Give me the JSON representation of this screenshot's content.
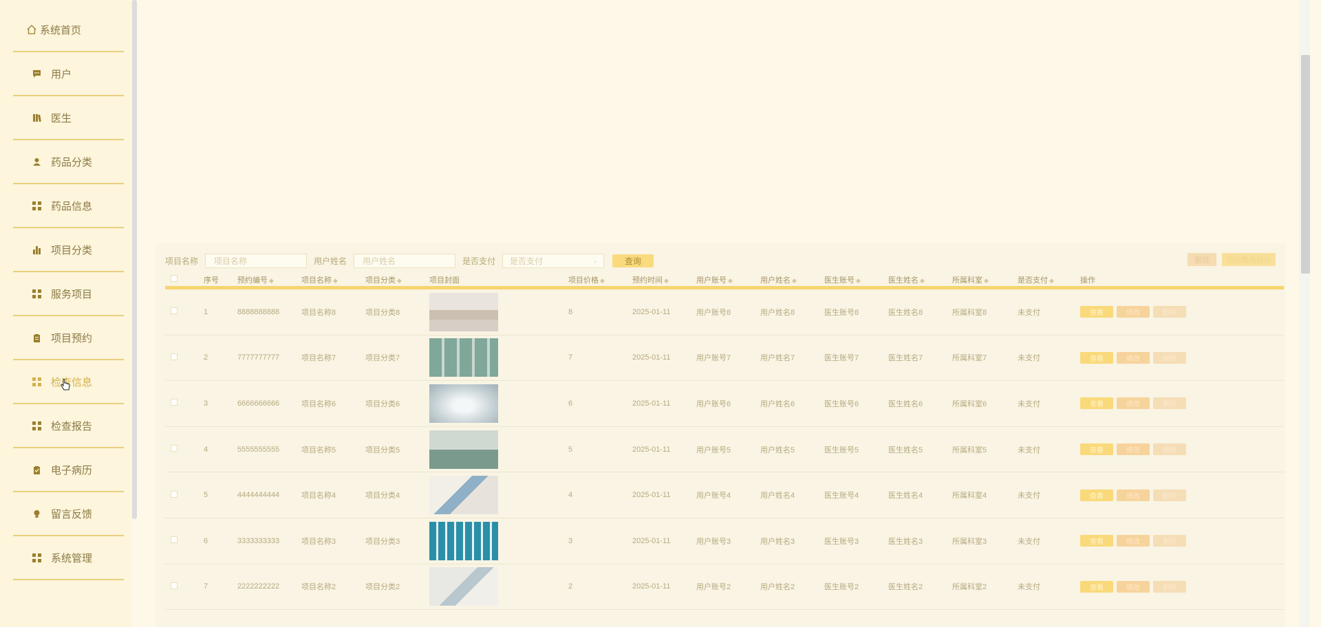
{
  "sidebar": {
    "items": [
      {
        "label": "系统首页",
        "icon": "home-icon"
      },
      {
        "label": "用户",
        "icon": "chat-icon"
      },
      {
        "label": "医生",
        "icon": "book-icon"
      },
      {
        "label": "药品分类",
        "icon": "user-icon"
      },
      {
        "label": "药品信息",
        "icon": "grid-icon"
      },
      {
        "label": "项目分类",
        "icon": "bar-chart-icon"
      },
      {
        "label": "服务项目",
        "icon": "grid-icon"
      },
      {
        "label": "项目预约",
        "icon": "clipboard-icon"
      },
      {
        "label": "检查信息",
        "icon": "grid-icon"
      },
      {
        "label": "检查报告",
        "icon": "grid-icon"
      },
      {
        "label": "电子病历",
        "icon": "clipboard-check-icon"
      },
      {
        "label": "留言反馈",
        "icon": "bulb-icon"
      },
      {
        "label": "系统管理",
        "icon": "grid-icon"
      }
    ]
  },
  "search": {
    "project_name_label": "项目名称",
    "project_name_placeholder": "项目名称",
    "user_name_label": "用户姓名",
    "user_name_placeholder": "用户姓名",
    "paid_label": "是否支付",
    "paid_placeholder": "是否支付",
    "query_button": "查询",
    "delete_button": "删除",
    "stat_button": "预约费用统计"
  },
  "table": {
    "headers": [
      "序号",
      "预约编号",
      "项目名称",
      "项目分类",
      "项目封面",
      "项目价格",
      "预约时间",
      "用户账号",
      "用户姓名",
      "医生账号",
      "医生姓名",
      "所属科室",
      "是否支付",
      "操作"
    ],
    "op_labels": {
      "view": "查看",
      "edit": "修改",
      "delete": "删除"
    },
    "rows": [
      {
        "no": "1",
        "code": "8888888888",
        "name": "项目名称8",
        "cat": "项目分类8",
        "price": "8",
        "time": "2025-01-11",
        "acc": "用户账号8",
        "uname": "用户姓名8",
        "dacc": "医生账号8",
        "dname": "医生姓名8",
        "dept": "所属科室8",
        "paid": "未支付"
      },
      {
        "no": "2",
        "code": "7777777777",
        "name": "项目名称7",
        "cat": "项目分类7",
        "price": "7",
        "time": "2025-01-11",
        "acc": "用户账号7",
        "uname": "用户姓名7",
        "dacc": "医生账号7",
        "dname": "医生姓名7",
        "dept": "所属科室7",
        "paid": "未支付"
      },
      {
        "no": "3",
        "code": "6666666666",
        "name": "项目名称6",
        "cat": "项目分类6",
        "price": "6",
        "time": "2025-01-11",
        "acc": "用户账号6",
        "uname": "用户姓名6",
        "dacc": "医生账号6",
        "dname": "医生姓名6",
        "dept": "所属科室6",
        "paid": "未支付"
      },
      {
        "no": "4",
        "code": "5555555555",
        "name": "项目名称5",
        "cat": "项目分类5",
        "price": "5",
        "time": "2025-01-11",
        "acc": "用户账号5",
        "uname": "用户姓名5",
        "dacc": "医生账号5",
        "dname": "医生姓名5",
        "dept": "所属科室5",
        "paid": "未支付"
      },
      {
        "no": "5",
        "code": "4444444444",
        "name": "项目名称4",
        "cat": "项目分类4",
        "price": "4",
        "time": "2025-01-11",
        "acc": "用户账号4",
        "uname": "用户姓名4",
        "dacc": "医生账号4",
        "dname": "医生姓名4",
        "dept": "所属科室4",
        "paid": "未支付"
      },
      {
        "no": "6",
        "code": "3333333333",
        "name": "项目名称3",
        "cat": "项目分类3",
        "price": "3",
        "time": "2025-01-11",
        "acc": "用户账号3",
        "uname": "用户姓名3",
        "dacc": "医生账号3",
        "dname": "医生姓名3",
        "dept": "所属科室3",
        "paid": "未支付"
      },
      {
        "no": "7",
        "code": "2222222222",
        "name": "项目名称2",
        "cat": "项目分类2",
        "price": "2",
        "time": "2025-01-11",
        "acc": "用户账号2",
        "uname": "用户姓名2",
        "dacc": "医生账号2",
        "dname": "医生姓名2",
        "dept": "所属科室2",
        "paid": "未支付"
      }
    ]
  }
}
